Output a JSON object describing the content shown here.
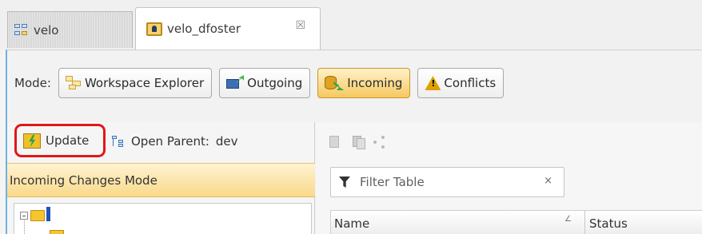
{
  "tabs": [
    {
      "label": "velo",
      "active": false,
      "icon": "workspace-icon"
    },
    {
      "label": "velo_dfoster",
      "active": true,
      "icon": "user-workspace-icon",
      "close_glyph": "☒"
    }
  ],
  "mode": {
    "label": "Mode:",
    "buttons": [
      {
        "label": "Workspace Explorer",
        "icon": "workspace-explorer-icon",
        "selected": false
      },
      {
        "label": "Outgoing",
        "icon": "outgoing-icon",
        "selected": false
      },
      {
        "label": "Incoming",
        "icon": "incoming-icon",
        "selected": true
      },
      {
        "label": "Conflicts",
        "icon": "warning-icon",
        "selected": false
      }
    ]
  },
  "left_toolbar": {
    "update_label": "Update",
    "open_parent_label": "Open Parent:",
    "open_parent_value": "dev"
  },
  "left_pane": {
    "header": "Incoming Changes Mode"
  },
  "right_pane": {
    "filter": {
      "placeholder": "Filter Table",
      "clear_glyph": "×"
    },
    "columns": [
      {
        "label": "Name",
        "sort_glyph": "∠"
      },
      {
        "label": "Status"
      }
    ]
  },
  "colors": {
    "highlight_border": "#e0171b",
    "active_mode_fill": "#f6c860",
    "panel_accent": "#6fb1e3",
    "mode_header_fill": "#f9d98a"
  }
}
